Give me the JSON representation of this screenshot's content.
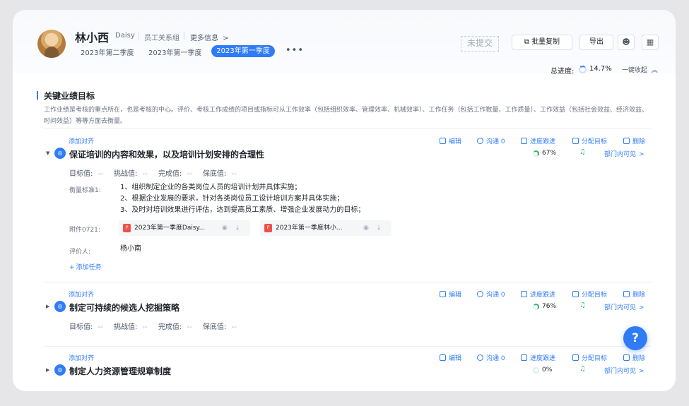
{
  "profile": {
    "name": "林小西",
    "english_name": "Daisy",
    "department": "员工关系组",
    "more_info": "更多信息",
    "more_info_arrow": ">"
  },
  "period_tabs": [
    "2023年第二季度",
    "2023年第一季度",
    "2023年第一季度"
  ],
  "more_dots": "•••",
  "stamp": "未提交",
  "actions": {
    "batch_copy": "批量复制",
    "export": "导出"
  },
  "progress": {
    "label": "总进度:",
    "value": "14.7%",
    "collapse": "一键收起"
  },
  "section": {
    "title": "关键业绩目标",
    "description": "工作业绩是考核的重点所在，也是考核的中心。评价、考核工作成绩的项目或指标可从工作效率（包括组织效率、管理效率、机械效率）、工作任务（包括工作数量、工作质量）、工作效益（包括社会效益、经济效益、时间效益）等等方面去衡量。"
  },
  "goal_actions": {
    "align": "添加对齐",
    "edit": "编辑",
    "communicate": "沟通 0",
    "track": "进度跟进",
    "assign": "分配目标",
    "delete": "删除",
    "visibility": "部门内可见",
    "visibility_arrow": ">"
  },
  "metric_labels": {
    "target": "目标值:",
    "challenge": "挑战值:",
    "actual": "完成值:",
    "floor": "保底值:",
    "empty": "--"
  },
  "goals": [
    {
      "title": "保证培训的内容和效果，以及培训计划安排的合理性",
      "percent": "67%",
      "criteria_label": "衡量标准1:",
      "criteria": [
        "1、组织制定企业的各类岗位人员的培训计划并具体实施；",
        "2、根据企业发展的要求，针对各类岗位员工设计培训方案并具体实施；",
        "3、及时对培训效果进行评估，达到提高员工素质、增强企业发展动力的目标；"
      ],
      "attachment_label": "附件0721:",
      "attachments": [
        "2023年第一季度Daisy...",
        "2023年第一季度林小..."
      ],
      "reviewer_label": "评价人:",
      "reviewer": "杨小南",
      "add_task": "添加任务"
    },
    {
      "title": "制定可持续的候选人挖掘策略",
      "percent": "76%"
    },
    {
      "title": "制定人力资源管理规章制度",
      "percent": "0%"
    }
  ],
  "help_icon": "?"
}
